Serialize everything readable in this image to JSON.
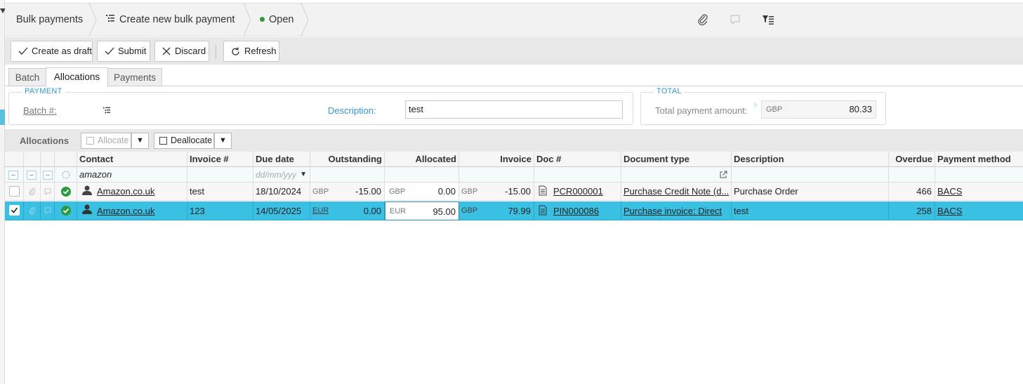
{
  "breadcrumb": {
    "root": "Bulk payments",
    "action": "Create new bulk payment",
    "status": "Open"
  },
  "toolbar": {
    "create_draft": "Create as draft",
    "submit": "Submit",
    "discard": "Discard",
    "refresh": "Refresh"
  },
  "tabs": [
    "Batch",
    "Allocations",
    "Payments"
  ],
  "payment": {
    "legend": "PAYMENT",
    "batch_label": "Batch #:",
    "description_label": "Description:",
    "description_value": "test"
  },
  "total": {
    "legend": "TOTAL",
    "label": "Total payment amount:",
    "help": "?",
    "currency": "GBP",
    "amount": "80.33"
  },
  "allocations_bar": {
    "title": "Allocations",
    "allocate": "Allocate",
    "deallocate": "Deallocate"
  },
  "grid": {
    "columns": [
      "Contact",
      "Invoice #",
      "Due date",
      "Outstanding",
      "Allocated",
      "Invoice",
      "Doc #",
      "Document type",
      "Description",
      "Overdue",
      "Payment method"
    ],
    "filter": {
      "contact": "amazon",
      "due_date_placeholder": "dd/mm/yyy"
    },
    "rows": [
      {
        "contact": "Amazon.co.uk",
        "invoice_no": "test",
        "due_date": "18/10/2024",
        "out_cur": "GBP",
        "outstanding": "-15.00",
        "alloc_cur": "GBP",
        "allocated": "0.00",
        "inv_cur": "GBP",
        "invoice": "-15.00",
        "doc_no": "PCR000001",
        "doc_type": "Purchase Credit Note (d...",
        "description": "Purchase Order",
        "overdue": "466",
        "method": "BACS",
        "selected": false
      },
      {
        "contact": "Amazon.co.uk",
        "invoice_no": "123",
        "due_date": "14/05/2025",
        "out_cur": "EUR",
        "outstanding": "0.00",
        "alloc_cur": "EUR",
        "allocated": "95.00",
        "inv_cur": "GBP",
        "invoice": "79.99",
        "doc_no": "PIN000086",
        "doc_type": "Purchase invoice: Direct",
        "description": "test",
        "overdue": "258",
        "method": "BACS",
        "selected": true
      }
    ]
  },
  "icons": {
    "attach": "paperclip-icon",
    "comment": "comment-icon",
    "filter": "filter-list-icon",
    "status_ok": "check-circle-icon",
    "person": "person-icon",
    "doc": "document-icon"
  },
  "colors": {
    "selected_row": "#3ac0e2",
    "accent": "#3399cc",
    "status_ok": "#2b9b3f"
  }
}
